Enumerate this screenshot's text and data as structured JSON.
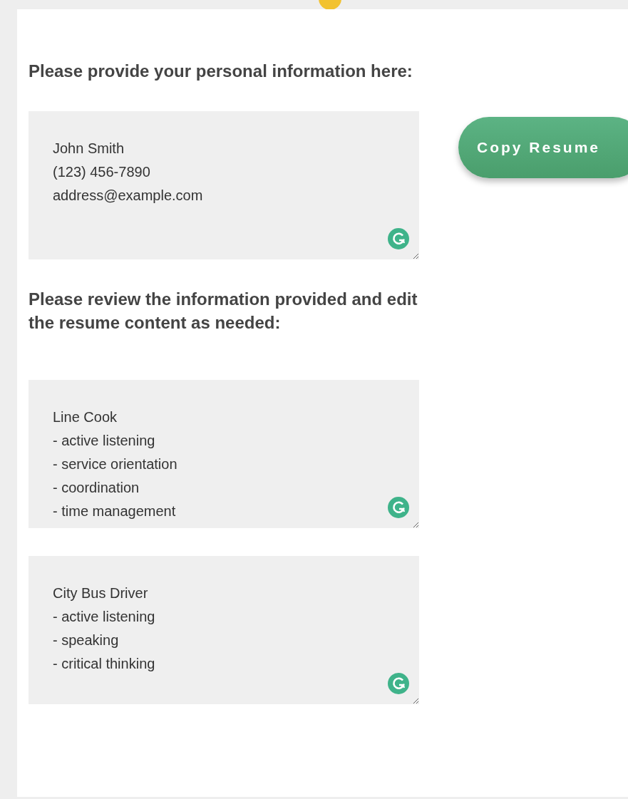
{
  "prompts": [
    {
      "text": "Please provide your personal information here:",
      "fields": [
        {
          "lines": [
            "John Smith",
            "(123) 456-7890",
            "address@example.com"
          ]
        }
      ]
    },
    {
      "text": "Please review the information provided and edit the resume content as needed:",
      "fields": [
        {
          "lines": [
            "Line Cook",
            "- active listening",
            "- service orientation",
            "- coordination",
            "- time management"
          ]
        },
        {
          "lines": [
            "City Bus Driver",
            "- active listening",
            "- speaking",
            "- critical thinking"
          ]
        }
      ]
    }
  ],
  "copy_button": {
    "label": "Copy Resume"
  }
}
